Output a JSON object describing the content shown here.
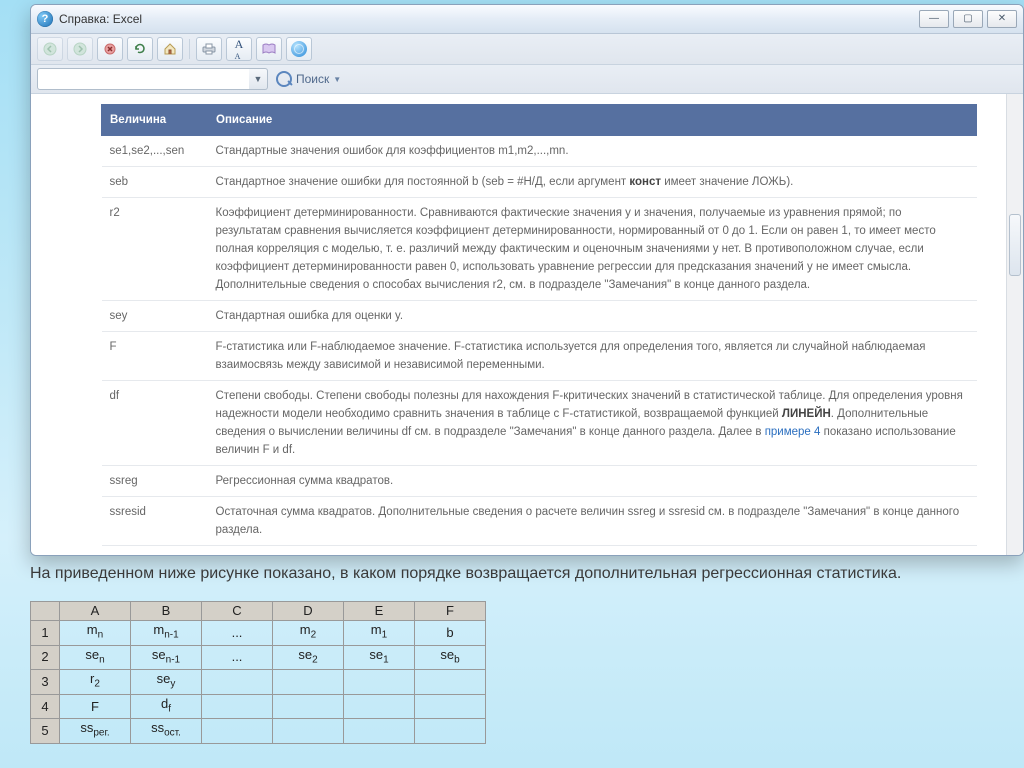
{
  "window": {
    "title": "Справка: Excel",
    "icon_glyph": "?"
  },
  "toolbar": {
    "back": "back",
    "forward": "forward",
    "stop": "stop",
    "refresh": "refresh",
    "home": "home",
    "print": "print",
    "font_size": "font-size",
    "toc": "table-of-contents",
    "pin": "pin"
  },
  "search": {
    "label": "Поиск",
    "value": "",
    "placeholder": ""
  },
  "table": {
    "headers": {
      "param": "Величина",
      "desc": "Описание"
    },
    "rows": [
      {
        "term": "se1,se2,...,sen",
        "desc": "Стандартные значения ошибок для коэффициентов m1,m2,...,mn."
      },
      {
        "term": "seb",
        "desc_html": "Стандартное значение ошибки для постоянной b (seb = #Н/Д, если аргумент <b class=\"term-bold\">конст</b> имеет значение ЛОЖЬ)."
      },
      {
        "term": "r2",
        "desc": "Коэффициент детерминированности. Сравниваются фактические значения y и значения, получаемые из уравнения прямой; по результатам сравнения вычисляется коэффициент детерминированности, нормированный от 0 до 1. Если он равен 1, то имеет место полная корреляция с моделью, т. е. различий между фактическим и оценочным значениями y нет. В противоположном случае, если коэффициент детерминированности равен 0, использовать уравнение регрессии для предсказания значений y не имеет смысла. Дополнительные сведения о способах вычисления r2, см. в подразделе \"Замечания\" в конце данного раздела."
      },
      {
        "term": "sey",
        "desc": "Стандартная ошибка для оценки y."
      },
      {
        "term": "F",
        "desc": "F-статистика или F-наблюдаемое значение. F-статистика используется для определения того, является ли случайной наблюдаемая взаимосвязь между зависимой и независимой переменными."
      },
      {
        "term": "df",
        "desc_html": "Степени свободы. Степени свободы полезны для нахождения F-критических значений в статистической таблице. Для определения уровня надежности модели необходимо сравнить значения в таблице с F-статистикой, возвращаемой функцией <b class=\"term-bold\">ЛИНЕЙН</b>. Дополнительные сведения о вычислении величины df см. в подразделе \"Замечания\" в конце данного раздела. Далее в <span class=\"link\">примере 4</span> показано использование величин F и df."
      },
      {
        "term": "ssreg",
        "desc": "Регрессионная сумма квадратов."
      },
      {
        "term": "ssresid",
        "desc": "Остаточная сумма квадратов. Дополнительные сведения о расчете величин ssreg и ssresid см. в подразделе \"Замечания\" в конце данного раздела."
      }
    ]
  },
  "footer_text": "На приведенном ниже рисунке показано, в каком порядке возвращается дополнительная регрессионная статистика.",
  "output_grid": {
    "cols": [
      "A",
      "B",
      "C",
      "D",
      "E",
      "F"
    ],
    "rows": [
      [
        "m<sub>n</sub>",
        "m<sub>n-1</sub>",
        "...",
        "m<sub>2</sub>",
        "m<sub>1</sub>",
        "b"
      ],
      [
        "se<sub>n</sub>",
        "se<sub>n-1</sub>",
        "...",
        "se<sub>2</sub>",
        "se<sub>1</sub>",
        "se<sub>b</sub>"
      ],
      [
        "r<sub>2</sub>",
        "se<sub>y</sub>",
        "",
        "",
        "",
        ""
      ],
      [
        "F",
        "d<sub>f</sub>",
        "",
        "",
        "",
        ""
      ],
      [
        "ss<sub>рег.</sub>",
        "ss<sub>ост.</sub>",
        "",
        "",
        "",
        ""
      ]
    ]
  }
}
